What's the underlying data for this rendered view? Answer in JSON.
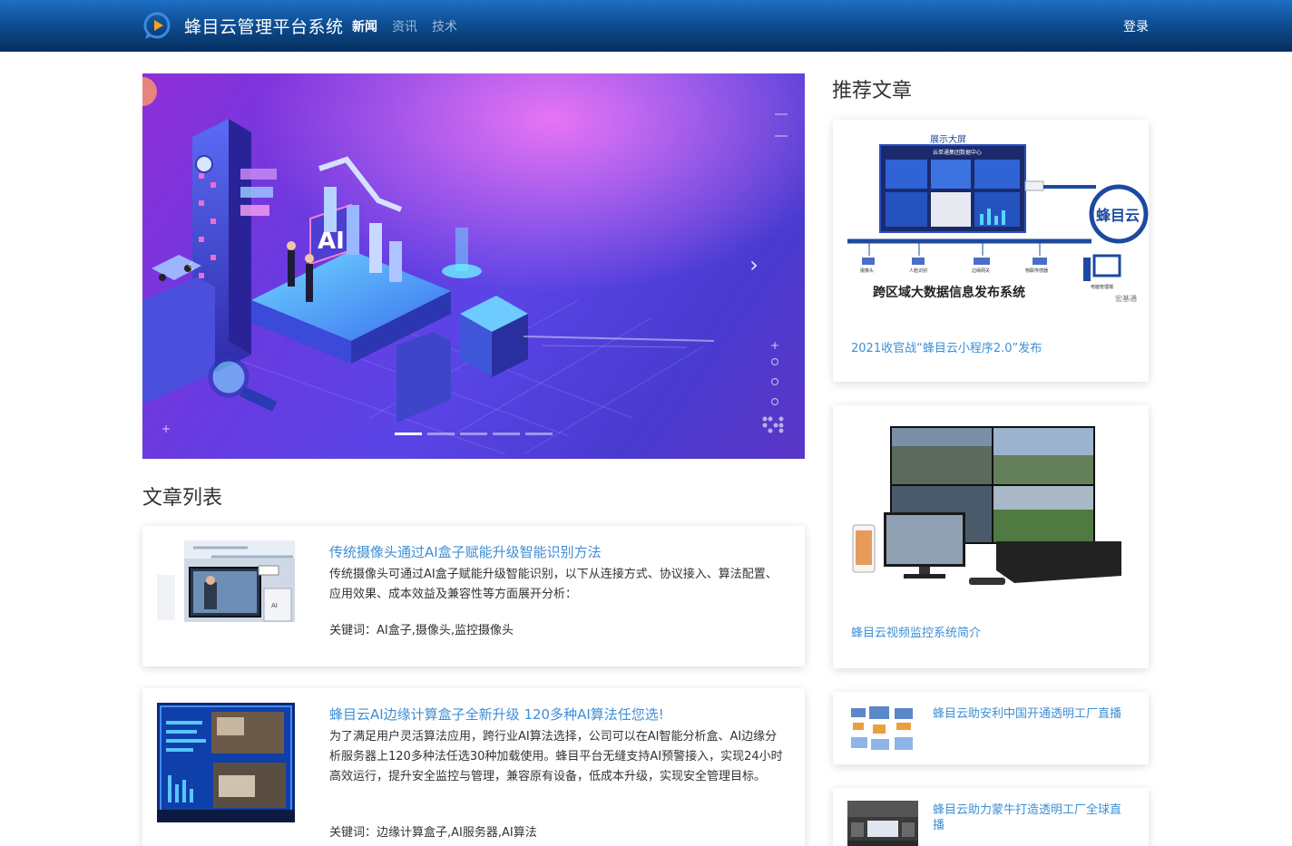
{
  "navbar": {
    "brand": "蜂目云管理平台系统",
    "nav_items": [
      {
        "label": "新闻",
        "active": true
      },
      {
        "label": "资讯",
        "active": false
      },
      {
        "label": "技术",
        "active": false
      }
    ],
    "login": "登录"
  },
  "carousel": {
    "indicators_count": 5,
    "active_index": 0,
    "next_icon": "chevron-right-icon",
    "prev_icon": "chevron-left-icon"
  },
  "sections": {
    "article_list_title": "文章列表",
    "recommended_title": "推荐文章"
  },
  "articles": [
    {
      "title": "传统摄像头通过AI盒子赋能升级智能识别方法",
      "summary": "传统摄像头可通过AI盒子赋能升级智能识别，以下从连接方式、协议接入、算法配置、应用效果、成本效益及兼容性等方面展开分析：",
      "keywords": "关键词：AI盒子,摄像头,监控摄像头"
    },
    {
      "title": "蜂目云AI边缘计算盒子全新升级 120多种AI算法任您选!",
      "summary": "为了满足用户灵活算法应用，跨行业AI算法选择，公司可以在AI智能分析盒、AI边缘分析服务器上120多种法任选30种加载使用。蜂目平台无缝支持AI预警接入，实现24小时高效运行，提升安全监控与管理，兼容原有设备，低成本升级，实现安全管理目标。",
      "keywords": "关键词：边缘计算盒子,AI服务器,AI算法"
    }
  ],
  "recommended": [
    {
      "title": "2021收官战“蜂目云小程序2.0”发布",
      "image_text": {
        "screen_label": "展示大屏",
        "screen_header": "云单通集团数据中心",
        "brand_circle": "蜂目云",
        "system_name": "跨区域大数据信息发布系统",
        "watermark": "宏基通",
        "device_labels": [
          "摄像头",
          "人脸识别",
          "边缘网关",
          "物联传感器",
          "电脑管理端"
        ]
      }
    },
    {
      "title": "蜂目云视频监控系统简介"
    },
    {
      "title": "蜂目云助安利中国开通透明工厂直播"
    },
    {
      "title": "蜂目云助力蒙牛打造透明工厂全球直播"
    }
  ],
  "colors": {
    "nav_top": "#1e6fc4",
    "nav_bottom": "#062e5d",
    "link_blue": "#3d8fd6",
    "carousel_purple": "#6a3ae0"
  }
}
